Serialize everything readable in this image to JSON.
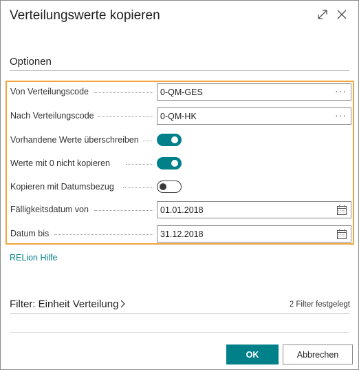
{
  "dialog": {
    "title": "Verteilungswerte kopieren"
  },
  "options": {
    "section_title": "Optionen",
    "fields": {
      "von_verteilungscode": {
        "label": "Von Verteilungscode",
        "value": "0-QM-GES"
      },
      "nach_verteilungscode": {
        "label": "Nach Verteilungscode",
        "value": "0-QM-HK"
      },
      "vorhandene_werte": {
        "label": "Vorhandene Werte überschreiben",
        "checked": true
      },
      "werte_mit_0": {
        "label": "Werte mit 0 nicht kopieren",
        "checked": true
      },
      "kopieren_datumsbezug": {
        "label": "Kopieren mit Datumsbezug",
        "checked": false
      },
      "faelligkeitsdatum_von": {
        "label": "Fälligkeitsdatum von",
        "value": "01.01.2018"
      },
      "datum_bis": {
        "label": "Datum bis",
        "value": "31.12.2018"
      }
    },
    "lookup_glyph": "···"
  },
  "help_link": "RELion Hilfe",
  "filter": {
    "title": "Filter: Einheit Verteilung",
    "count_text": "2 Filter festgelegt"
  },
  "buttons": {
    "ok": "OK",
    "cancel": "Abbrechen"
  },
  "colors": {
    "accent": "#00818a",
    "highlight": "#f0a43a"
  },
  "icons": {
    "expand": "expand-icon",
    "close": "close-icon",
    "calendar": "calendar-icon",
    "chevron": "chevron-right-icon"
  }
}
